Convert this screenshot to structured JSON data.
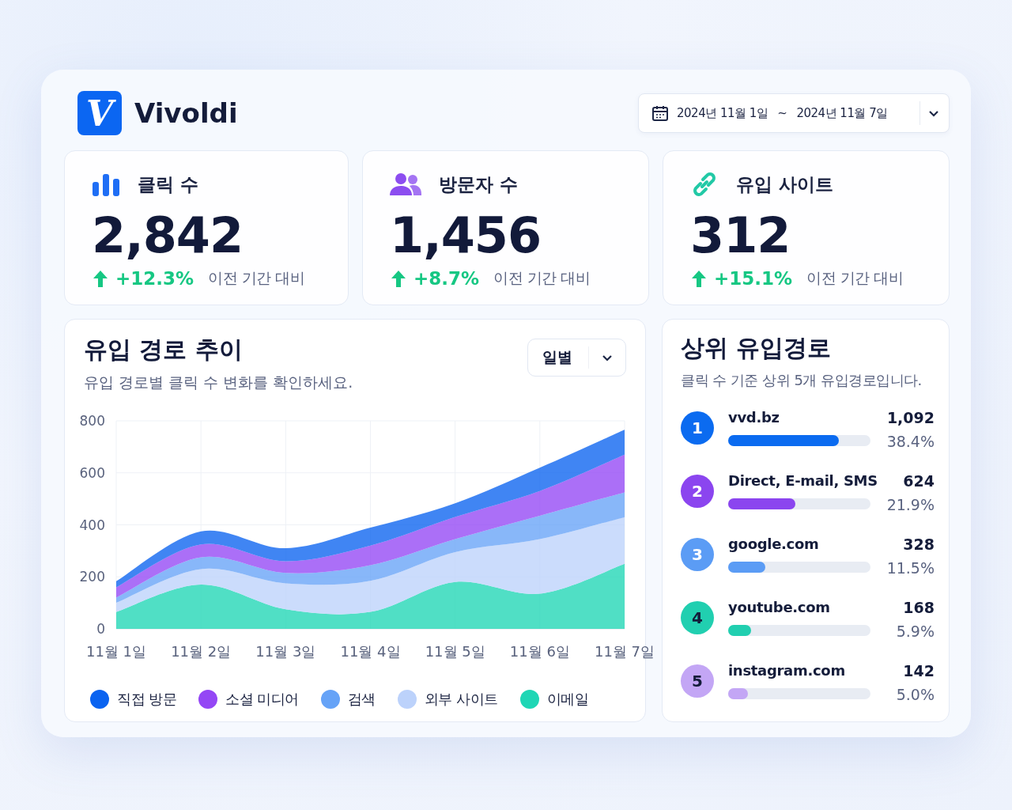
{
  "header": {
    "logo": {
      "mark": "V",
      "name": "Vivoldi"
    },
    "date_range": {
      "start": "2024년 11월 1일",
      "separator": "~",
      "end": "2024년 11월 7일"
    }
  },
  "stats": [
    {
      "kind": "clicks",
      "label": "클릭 수",
      "value": "2,842",
      "change": "+12.3%",
      "note": "이전 기간 대비"
    },
    {
      "kind": "visitors",
      "label": "방문자 수",
      "value": "1,456",
      "change": "+8.7%",
      "note": "이전 기간 대비"
    },
    {
      "kind": "referrers",
      "label": "유입 사이트",
      "value": "312",
      "change": "+15.1%",
      "note": "이전 기간 대비"
    }
  ],
  "trend_panel": {
    "title": "유입 경로 추이",
    "subtitle": "유입 경로별 클릭 수 변화를 확인하세요.",
    "period": "일별",
    "chart_data": {
      "type": "area",
      "stacked": true,
      "grid": true,
      "categories": [
        "11월 1일",
        "11월 2일",
        "11월 3일",
        "11월 4일",
        "11월 5일",
        "11월 6일",
        "11월 7일"
      ],
      "ylim": [
        0,
        800
      ],
      "yticks": [
        0,
        200,
        400,
        600,
        800
      ],
      "series": [
        {
          "name": "직접 방문",
          "color": "#0a63f0",
          "values": [
            23,
            50,
            50,
            69,
            53,
            90,
            96
          ]
        },
        {
          "name": "소셜 미디어",
          "color": "#9447f5",
          "values": [
            40,
            50,
            45,
            75,
            85,
            95,
            145
          ]
        },
        {
          "name": "검색",
          "color": "#66a3f7",
          "values": [
            20,
            45,
            40,
            60,
            50,
            90,
            95
          ]
        },
        {
          "name": "외부 사이트",
          "color": "#bcd2fb",
          "values": [
            35,
            60,
            100,
            120,
            115,
            210,
            180
          ]
        },
        {
          "name": "이메일",
          "color": "#1fd6b5",
          "values": [
            65,
            170,
            75,
            65,
            180,
            135,
            250
          ]
        }
      ]
    }
  },
  "top_sources": {
    "title": "상위 유입경로",
    "subtitle": "클릭 수 기준 상위 5개 유입경로입니다.",
    "items": [
      {
        "rank": "1",
        "name": "vvd.bz",
        "clicks": "1,092",
        "share": "38.4%",
        "level": 0.78,
        "color": "#0b6bf0"
      },
      {
        "rank": "2",
        "name": "Direct, E-mail, SMS",
        "clicks": "624",
        "share": "21.9%",
        "level": 0.47,
        "color": "#8b45ef"
      },
      {
        "rank": "3",
        "name": "google.com",
        "clicks": "328",
        "share": "11.5%",
        "level": 0.26,
        "color": "#5b9cf5"
      },
      {
        "rank": "4",
        "name": "youtube.com",
        "clicks": "168",
        "share": "5.9%",
        "level": 0.16,
        "color": "#21cfb0"
      },
      {
        "rank": "5",
        "name": "instagram.com",
        "clicks": "142",
        "share": "5.0%",
        "level": 0.14,
        "color": "#c3a6f5"
      }
    ]
  }
}
